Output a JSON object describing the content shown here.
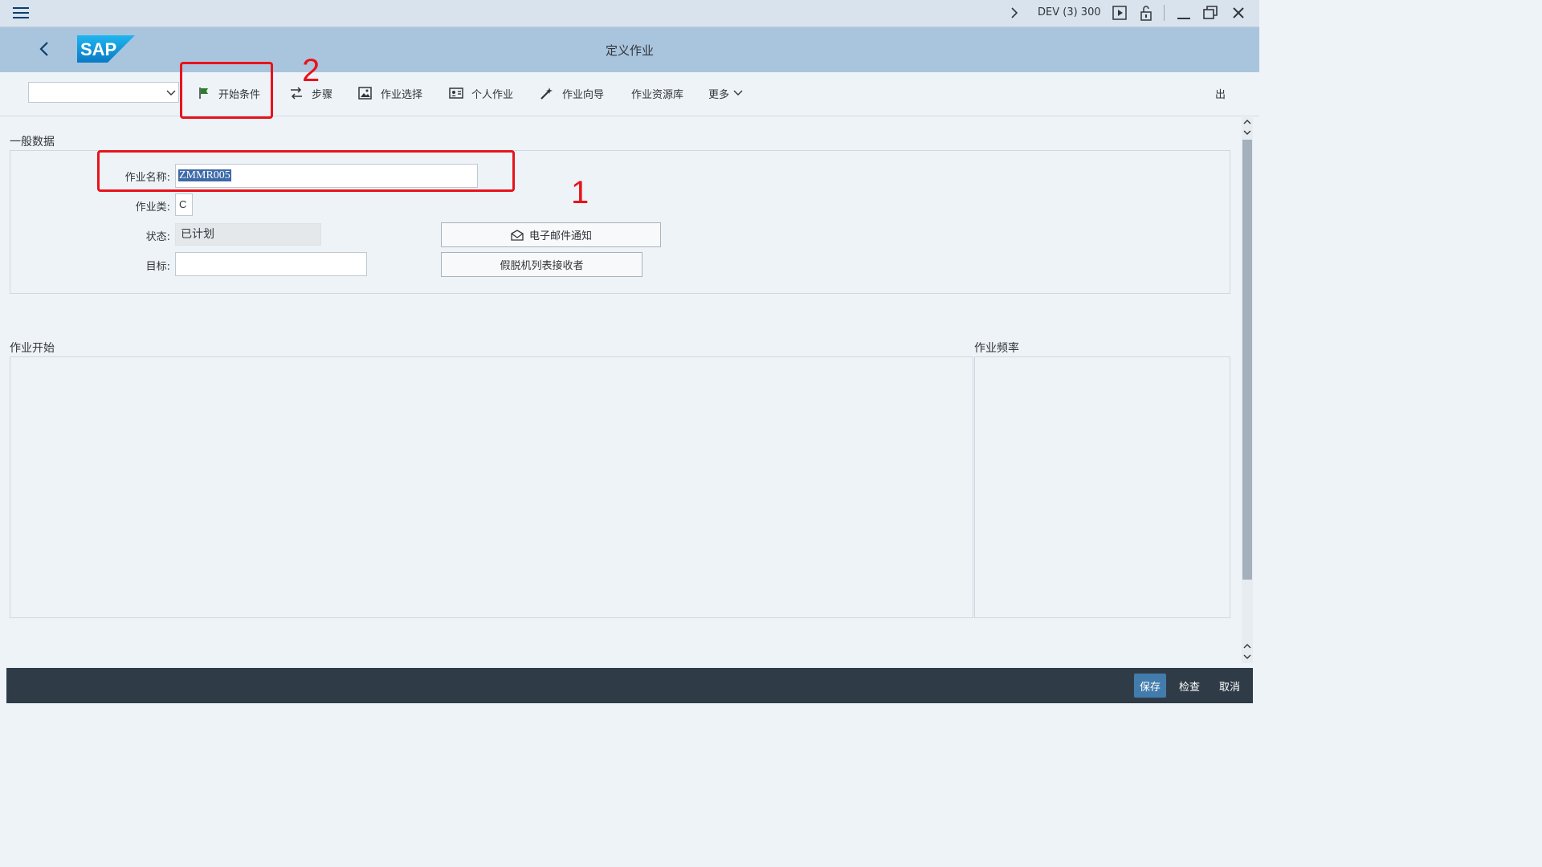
{
  "titlebar": {
    "system": "DEV (3) 300",
    "icons": [
      "menu-icon",
      "chevron-right-icon",
      "play-icon",
      "lock-icon",
      "minimize-icon",
      "restore-icon",
      "close-icon"
    ]
  },
  "header": {
    "title": "定义作业",
    "logo": "SAP"
  },
  "toolbar": {
    "start_condition": "开始条件",
    "steps": "步骤",
    "job_selection": "作业选择",
    "own_jobs": "个人作业",
    "job_wizard": "作业向导",
    "job_repository": "作业资源库",
    "more": "更多",
    "exit": "出"
  },
  "general": {
    "title": "一般数据",
    "job_name_label": "作业名称:",
    "job_name_value": "ZMMR005",
    "job_class_label": "作业类:",
    "job_class_value": "C",
    "status_label": "状态:",
    "status_value": "已计划",
    "target_label": "目标:",
    "target_value": "",
    "email_button": "电子邮件通知",
    "spool_button": "假脱机列表接收者"
  },
  "job_start": {
    "title": "作业开始"
  },
  "job_frequency": {
    "title": "作业频率"
  },
  "footer": {
    "save": "保存",
    "check": "检查",
    "cancel": "取消"
  },
  "annotations": {
    "label_1": "1",
    "label_2": "2",
    "color": "#e8131b"
  },
  "colors": {
    "shell": "#a9c5de",
    "footer": "#2f3c48",
    "primary_button": "#427cac"
  }
}
